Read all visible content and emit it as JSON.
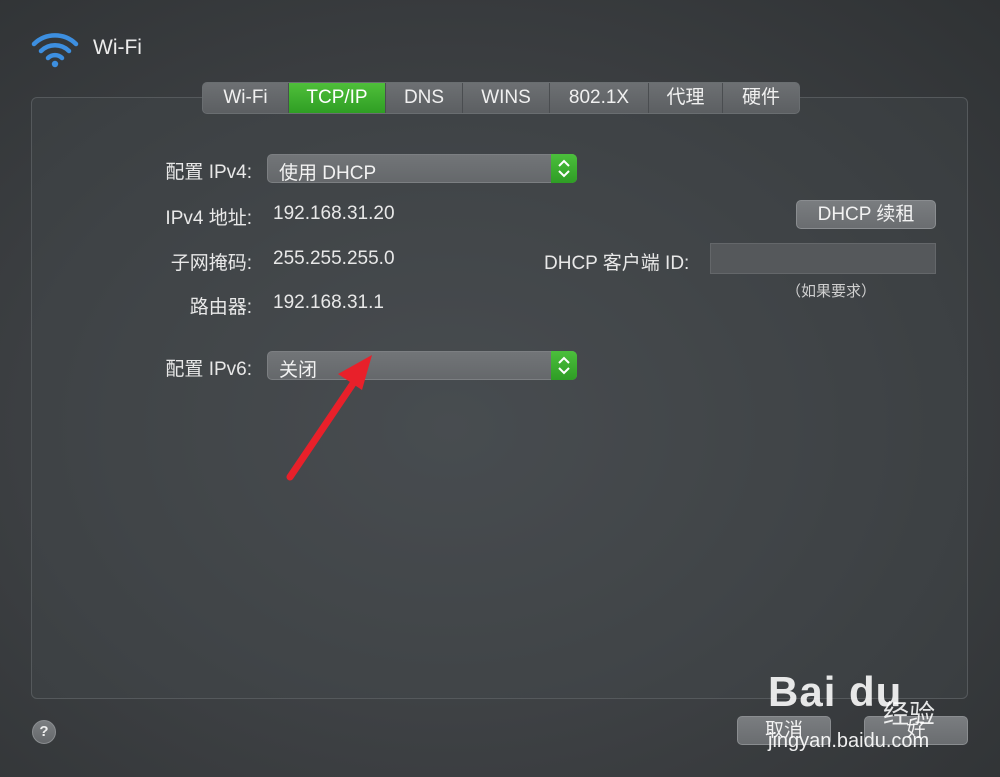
{
  "header": {
    "title": "Wi-Fi",
    "icon": "wifi-icon",
    "icon_color": "#3d8fe0"
  },
  "tabs": [
    {
      "label": "Wi-Fi",
      "active": false
    },
    {
      "label": "TCP/IP",
      "active": true
    },
    {
      "label": "DNS",
      "active": false
    },
    {
      "label": "WINS",
      "active": false
    },
    {
      "label": "802.1X",
      "active": false
    },
    {
      "label": "代理",
      "active": false
    },
    {
      "label": "硬件",
      "active": false
    }
  ],
  "form": {
    "ipv4_config_label": "配置 IPv4:",
    "ipv4_config_value": "使用 DHCP",
    "ipv4_address_label": "IPv4 地址:",
    "ipv4_address_value": "192.168.31.20",
    "subnet_label": "子网掩码:",
    "subnet_value": "255.255.255.0",
    "router_label": "路由器:",
    "router_value": "192.168.31.1",
    "ipv6_config_label": "配置 IPv6:",
    "ipv6_config_value": "关闭",
    "renew_button": "DHCP 续租",
    "dhcp_client_id_label": "DHCP 客户端 ID:",
    "dhcp_client_id_value": "",
    "dhcp_client_id_hint": "（如果要求）"
  },
  "footer": {
    "help": "?",
    "cancel": "取消",
    "ok": "好"
  },
  "watermark": {
    "logo": "Bai du",
    "cn": "经验",
    "url": "jingyan.baidu.com"
  },
  "colors": {
    "accent": "#35a82a",
    "annotation_arrow": "#e8202a"
  }
}
